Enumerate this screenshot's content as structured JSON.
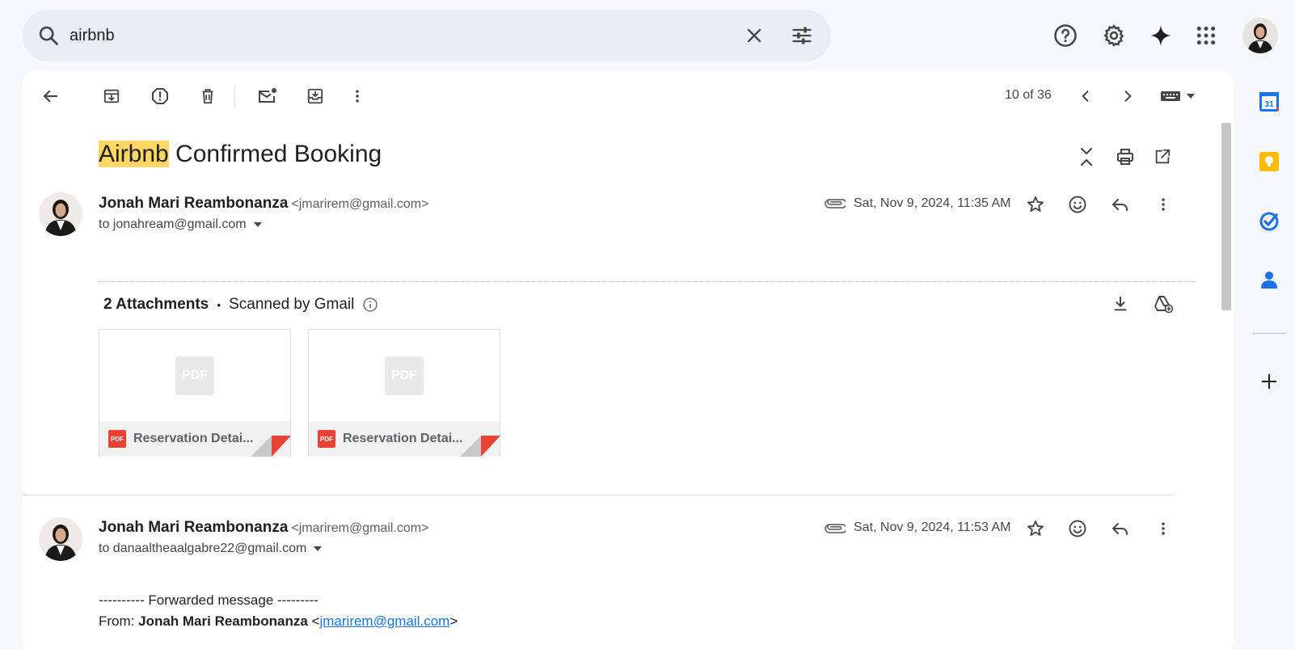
{
  "search": {
    "value": "airbnb"
  },
  "toolbar": {
    "counter": "10 of 36"
  },
  "thread": {
    "subject_highlight": "Airbnb",
    "subject_rest": " Confirmed Booking"
  },
  "messages": [
    {
      "sender_name": "Jonah Mari Reambonanza",
      "sender_email": "<jmarirem@gmail.com>",
      "to": "to jonahream@gmail.com",
      "date": "Sat, Nov 9, 2024, 11:35 AM"
    },
    {
      "sender_name": "Jonah Mari Reambonanza",
      "sender_email": "<jmarirem@gmail.com>",
      "to": "to danaaltheaalgabre22@gmail.com",
      "date": "Sat, Nov 9, 2024, 11:53 AM"
    }
  ],
  "attachments": {
    "count_label": "2 Attachments",
    "bullet": "•",
    "scanned": "Scanned by Gmail",
    "items": [
      {
        "name": "Reservation Detai...",
        "badge": "PDF",
        "thumb": "PDF"
      },
      {
        "name": "Reservation Detai...",
        "badge": "PDF",
        "thumb": "PDF"
      }
    ]
  },
  "forwarded": {
    "header": "---------- Forwarded message ---------",
    "from_label": "From: ",
    "from_name": "Jonah Mari Reambonanza",
    "from_open": " <",
    "from_email": "jmarirem@gmail.com",
    "from_close": ">"
  },
  "colors": {
    "highlight": "#fdd663",
    "link": "#1a73e8",
    "pdf_red": "#ea4335"
  },
  "rail": {
    "calendar_day": "31"
  }
}
